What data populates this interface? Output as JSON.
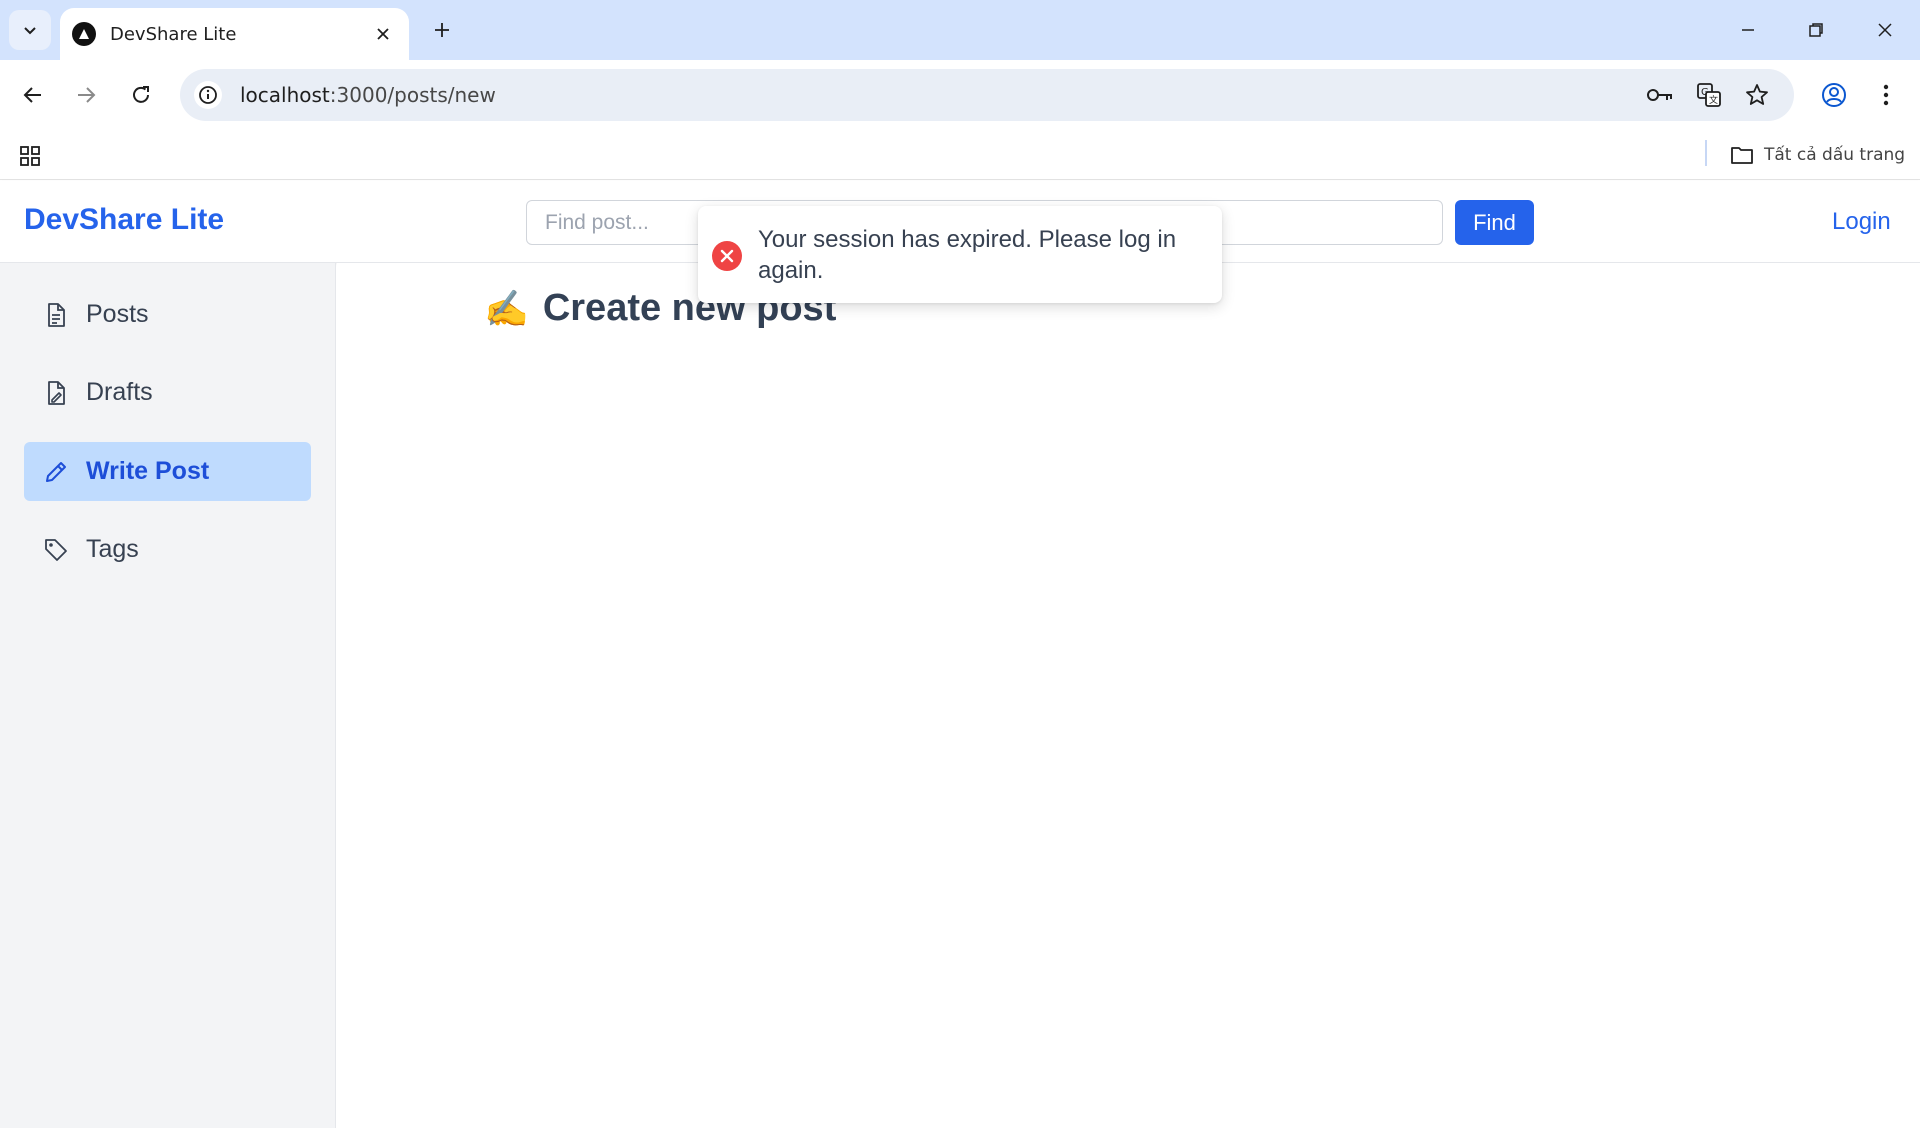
{
  "browser": {
    "tab_title": "DevShare Lite",
    "url_host": "localhost",
    "url_path": ":3000/posts/new",
    "bookmarks_all_label": "Tất cả dấu trang"
  },
  "app": {
    "brand": "DevShare Lite",
    "search": {
      "placeholder": "Find post...",
      "value": ""
    },
    "find_label": "Find",
    "login_label": "Login"
  },
  "sidebar": {
    "items": [
      {
        "label": "Posts",
        "icon": "document-icon",
        "active": false
      },
      {
        "label": "Drafts",
        "icon": "draft-document-icon",
        "active": false
      },
      {
        "label": "Write Post",
        "icon": "pencil-icon",
        "active": true
      },
      {
        "label": "Tags",
        "icon": "tag-icon",
        "active": false
      }
    ]
  },
  "main": {
    "title_emoji": "✍️",
    "title": "Create new post"
  },
  "toast": {
    "type": "error",
    "icon": "error-x-icon",
    "message": "Your session has expired. Please log in again."
  },
  "colors": {
    "brand": "#2563eb",
    "active_bg": "#bfdbfe",
    "error": "#ef4444",
    "chrome_tabstrip": "#d3e3fd"
  }
}
